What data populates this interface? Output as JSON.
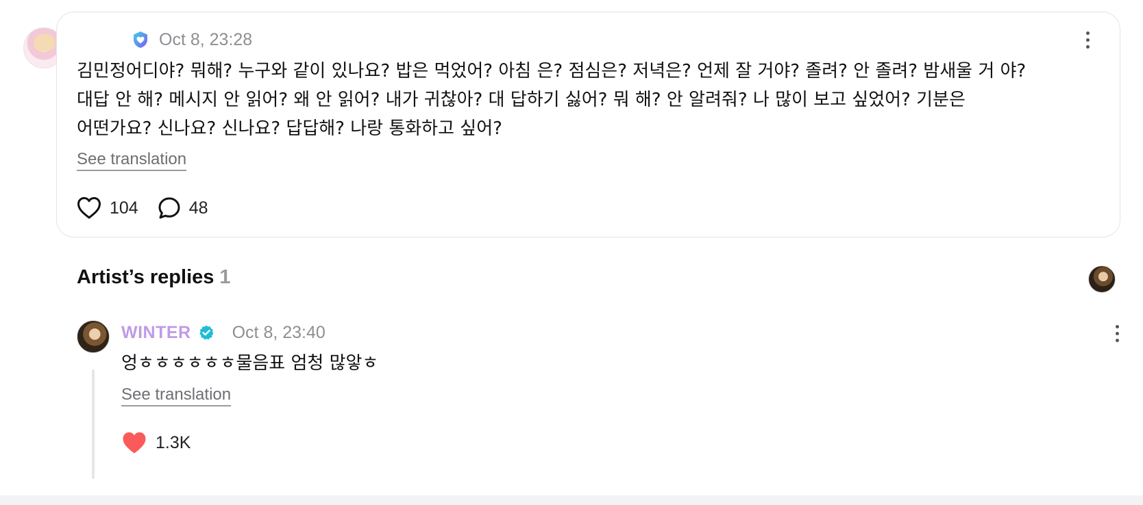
{
  "post": {
    "timestamp": "Oct 8, 23:28",
    "body": "김민정어디야? 뭐해? 누구와 같이 있나요? 밥은 먹었어? 아침 은? 점심은? 저녁은? 언제 잘 거야? 졸려? 안 졸려? 밤새울 거 야?\n대답 안 해? 메시지 안 읽어? 왜 안 읽어? 내가 귀찮아? 대 답하기 싫어? 뭐 해? 안 알려줘? 나 많이 보고 싶었어? 기분은\n어떤가요? 신나요? 신나요? 답답해? 나랑 통화하고 싶어?",
    "see_translation": "See translation",
    "likes": "104",
    "comments": "48",
    "icons": {
      "badge": "shield-heart-badge-icon",
      "like": "heart-outline-icon",
      "comment": "speech-bubble-icon",
      "more": "more-vertical-icon"
    }
  },
  "artist_replies": {
    "title": "Artist’s replies",
    "count": "1"
  },
  "reply": {
    "author": "WINTER",
    "timestamp": "Oct 8, 23:40",
    "body": "엉ㅎㅎㅎㅎㅎㅎ물음표 엄청 많앟ㅎ",
    "see_translation": "See translation",
    "likes": "1.3K",
    "icons": {
      "verified": "verified-check-icon",
      "like": "heart-filled-icon",
      "more": "more-vertical-icon"
    }
  },
  "colors": {
    "artist_name": "#c09ae6",
    "verified": "#1fbcd6",
    "like_filled": "#fa5a5a",
    "timestamp": "#8e8e93"
  }
}
